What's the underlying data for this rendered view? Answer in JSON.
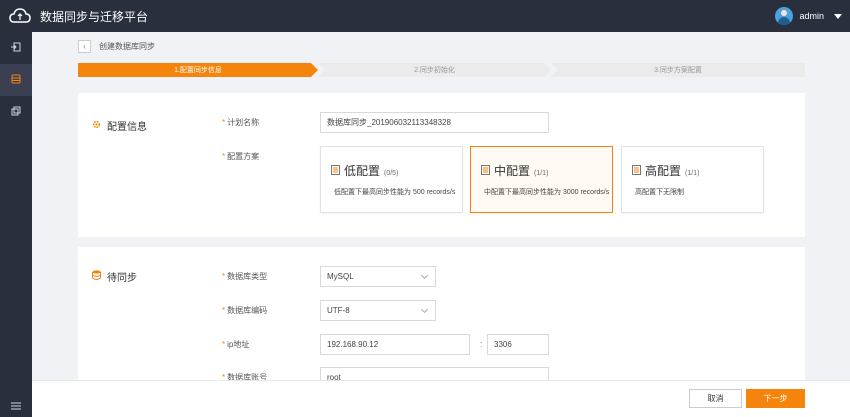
{
  "app": {
    "title": "数据同步与迁移平台",
    "username": "admin"
  },
  "sidebar": {
    "items": [
      {
        "icon": "login-icon"
      },
      {
        "icon": "database-icon",
        "active": true
      },
      {
        "icon": "copy-icon"
      }
    ]
  },
  "breadcrumb": {
    "text": "创建数据库同步"
  },
  "steps": [
    {
      "label": "1.配置同步信息",
      "active": true
    },
    {
      "label": "2.同步初始化",
      "active": false
    },
    {
      "label": "3.同步方案配置",
      "active": false
    }
  ],
  "config": {
    "section_title": "配置信息",
    "plan_name_label": "计划名称",
    "plan_name_value": "数据库同步_20190603211334832​8",
    "scheme_label": "配置方案",
    "plans": [
      {
        "name": "低配置",
        "count": "(0/5)",
        "desc": "低配置下最高同步性能为 500 records/s"
      },
      {
        "name": "中配置",
        "count": "(1/1)",
        "desc": "中配置下最高同步性能为 3000 records/s",
        "selected": true
      },
      {
        "name": "高配置",
        "count": "(1/1)",
        "desc": "高配置下无限制"
      }
    ]
  },
  "pending": {
    "section_title": "待同步",
    "db_type_label": "数据库类型",
    "db_type_value": "MySQL",
    "db_encoding_label": "数据库编码",
    "db_encoding_value": "UTF-8",
    "ip_label": "ip地址",
    "ip_value": "192.168.90.12",
    "port_value": "3306",
    "account_label": "数据库账号",
    "account_value": "root"
  },
  "footer": {
    "cancel_label": "取消",
    "next_label": "下一步"
  },
  "colors": {
    "accent": "#f5840c",
    "nav_bg": "#2a2f3d",
    "step_inactive": "#ebebeb"
  }
}
